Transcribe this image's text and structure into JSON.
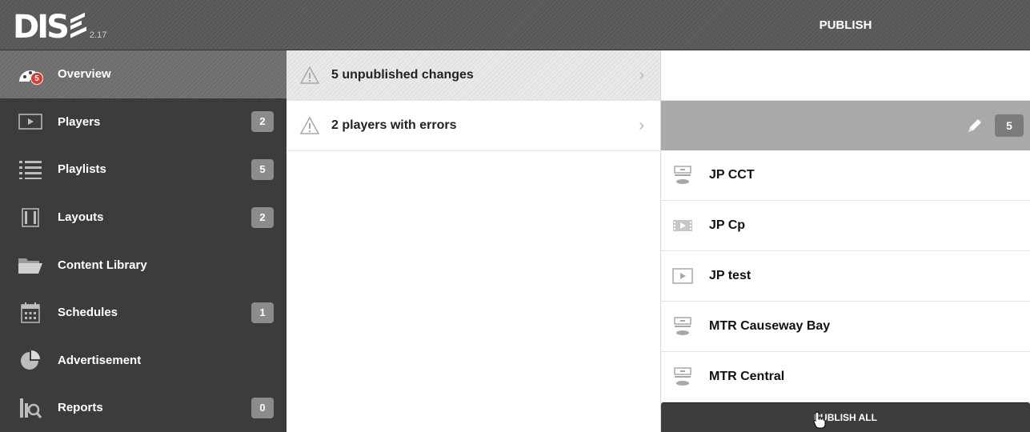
{
  "header": {
    "logo": "DIS",
    "version": "2.17",
    "panel_title": "PUBLISH"
  },
  "sidebar": {
    "items": [
      {
        "label": "Overview",
        "icon": "dashboard-icon",
        "badge": null,
        "alert": "5",
        "active": true
      },
      {
        "label": "Players",
        "icon": "player-icon",
        "badge": "2"
      },
      {
        "label": "Playlists",
        "icon": "playlist-icon",
        "badge": "5"
      },
      {
        "label": "Layouts",
        "icon": "layout-icon",
        "badge": "2"
      },
      {
        "label": "Content Library",
        "icon": "folder-icon",
        "badge": null
      },
      {
        "label": "Schedules",
        "icon": "calendar-icon",
        "badge": "1"
      },
      {
        "label": "Advertisement",
        "icon": "pie-chart-icon",
        "badge": null
      },
      {
        "label": "Reports",
        "icon": "reports-icon",
        "badge": "0"
      }
    ]
  },
  "changes": {
    "items": [
      {
        "label": "5 unpublished changes",
        "icon": "warning-icon"
      },
      {
        "label": "2 players with errors",
        "icon": "warning-icon"
      }
    ]
  },
  "publish_panel": {
    "group_count": "5",
    "players": [
      {
        "name": "JP CCT",
        "icon": "player-stack-icon"
      },
      {
        "name": "JP Cp",
        "icon": "film-icon"
      },
      {
        "name": "JP test",
        "icon": "play-box-icon"
      },
      {
        "name": "MTR Causeway Bay",
        "icon": "player-stack-icon"
      },
      {
        "name": "MTR Central",
        "icon": "player-stack-icon"
      }
    ],
    "publish_all_label": "PUBLISH ALL"
  },
  "colors": {
    "sidebar_bg": "#3c3c3c",
    "topbar_bg": "#585858",
    "badge_bg": "#8c8c8c",
    "alert": "#e03a2f"
  }
}
